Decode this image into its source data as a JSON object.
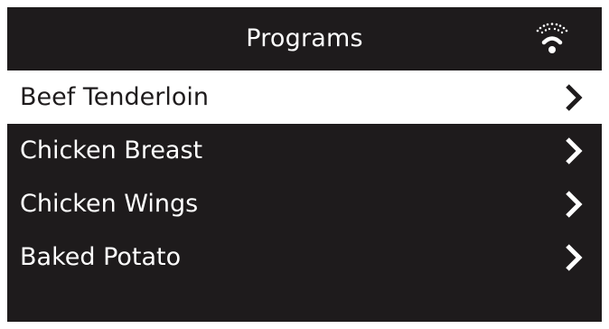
{
  "header": {
    "title": "Programs",
    "wifi_icon": "wifi-connecting-icon"
  },
  "programs": [
    {
      "label": "Beef Tenderloin",
      "selected": true,
      "icon": "chevron-right-icon"
    },
    {
      "label": "Chicken Breast",
      "selected": false,
      "icon": "chevron-right-icon"
    },
    {
      "label": "Chicken Wings",
      "selected": false,
      "icon": "chevron-right-icon"
    },
    {
      "label": "Baked Potato",
      "selected": false,
      "icon": "chevron-right-icon"
    }
  ],
  "colors": {
    "background": "#1e1b1c",
    "foreground": "#ffffff",
    "selected_background": "#ffffff",
    "selected_foreground": "#1e1b1c"
  }
}
